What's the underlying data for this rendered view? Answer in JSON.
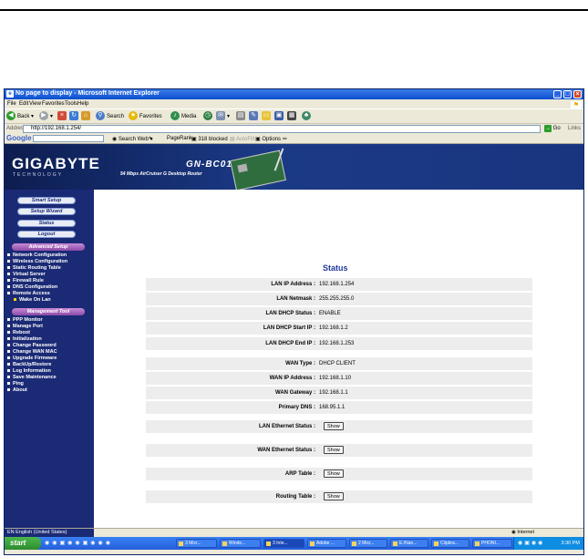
{
  "window": {
    "title": "No page to display - Microsoft Internet Explorer"
  },
  "menu": [
    "File",
    "Edit",
    "View",
    "Favorites",
    "Tools",
    "Help"
  ],
  "toolbar": {
    "back": "Back",
    "search": "Search",
    "favorites": "Favorites",
    "media": "Media"
  },
  "address": {
    "label": "Address",
    "url": "http://192.168.1.254/",
    "go": "Go",
    "links": "Links"
  },
  "googlebar": {
    "logo": "Google",
    "search_web": "Search Web",
    "pagerank": "PageRank",
    "blocked": "318 blocked",
    "autofill": "AutoFill",
    "options": "Options"
  },
  "banner": {
    "brand": "GIGABYTE",
    "brand_sub": "TECHNOLOGY",
    "model": "GN-BC01",
    "model_sub": "54 Mbps AirCruiser G Desktop Router"
  },
  "sidebar": {
    "pills": [
      "Smart Setup",
      "Setup Wizard",
      "Status",
      "Logout"
    ],
    "advanced_header": "Advanced Setup",
    "advanced_items": [
      "Network Configuration",
      "Wireless Configuration",
      "Static Routing Table",
      "Virtual Server",
      "Firewall Rule",
      "DNS Configuration",
      "Remote Access"
    ],
    "advanced_sub": "Wake On Lan",
    "management_header": "Management Tool",
    "management_items": [
      "PPP Monitor",
      "Manage Port",
      "Reboot",
      "Initialization",
      "Change Password",
      "Change WAN MAC",
      "Upgrade Firmware",
      "BackUp/Restore",
      "Log Information",
      "Save Maintenance",
      "Ping",
      "About"
    ]
  },
  "status": {
    "title": "Status",
    "rows": [
      {
        "label": "LAN IP Address :",
        "value": "192.168.1.254"
      },
      {
        "label": "LAN Netmask :",
        "value": "255.255.255.0"
      },
      {
        "label": "LAN DHCP Status :",
        "value": "ENABLE"
      },
      {
        "label": "LAN DHCP Start IP :",
        "value": "192.168.1.2"
      },
      {
        "label": "LAN DHCP End IP :",
        "value": "192.168.1.253"
      },
      {
        "label": "WAN Type :",
        "value": "DHCP CLIENT"
      },
      {
        "label": "WAN IP Address :",
        "value": "192.168.1.10"
      },
      {
        "label": "WAN Gateway :",
        "value": "192.168.1.1"
      },
      {
        "label": "Primary DNS :",
        "value": "168.95.1.1"
      }
    ],
    "show_rows": [
      {
        "label": "LAN Ethernet Status :",
        "button": "Show"
      },
      {
        "label": "WAN Ethernet Status :",
        "button": "Show"
      },
      {
        "label": "ARP Table :",
        "button": "Show"
      },
      {
        "label": "Routing Table :",
        "button": "Show"
      }
    ]
  },
  "statusbar": {
    "language": "EN English (United States)",
    "zone": "Internet"
  },
  "taskbar": {
    "start": "start",
    "tasks": [
      "3 Micr...",
      "Windo...",
      "3 Inte...",
      "Adobe ...",
      "2 Micr...",
      "E:/Nan...",
      "Clipbra...",
      "PHONI..."
    ],
    "clock": "3:30 PM"
  }
}
